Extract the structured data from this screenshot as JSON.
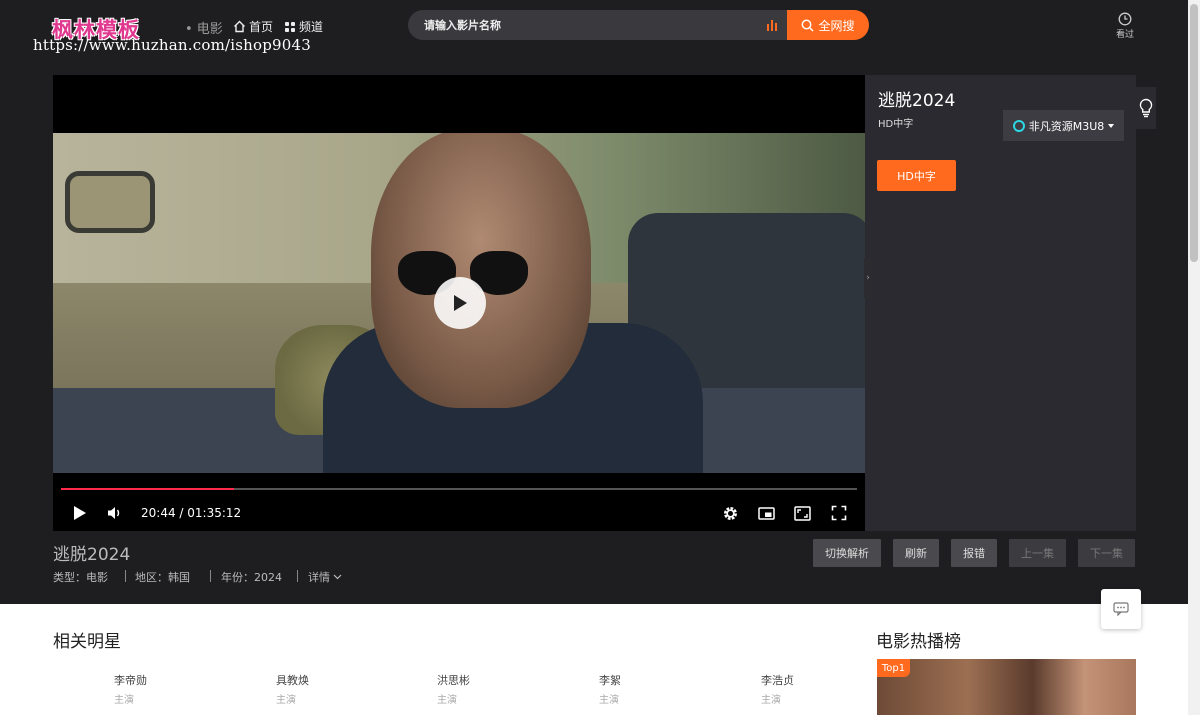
{
  "header": {
    "logo_text": "枫林模板",
    "logo_url": "https://www.huzhan.com/ishop9043",
    "category": "• 电影",
    "nav": [
      {
        "label": "首页",
        "icon": "home-icon"
      },
      {
        "label": "频道",
        "icon": "grid-icon"
      }
    ],
    "search_placeholder": "请输入影片名称",
    "search_button": "全网搜",
    "history_label": "看过"
  },
  "player": {
    "current_time": "20:44",
    "duration": "01:35:12",
    "time_display": "20:44 / 01:35:12",
    "progress_fraction": 0.2178,
    "progress_color": "#ff2a4a"
  },
  "panel": {
    "title": "逃脱2024",
    "subtitle": "HD中字",
    "source_label": "非凡资源M3U8",
    "episodes": [
      "HD中字"
    ]
  },
  "movie": {
    "title": "逃脱2024",
    "type": "类型：电影",
    "region": "地区：韩国",
    "year": "年份：2024",
    "details": "详情"
  },
  "actions": [
    "切换解析",
    "刷新",
    "报错",
    "上一集",
    "下一集"
  ],
  "stars_section": {
    "title": "相关明星",
    "stars": [
      {
        "name": "李帝勋",
        "role": "主演"
      },
      {
        "name": "具教焕",
        "role": "主演"
      },
      {
        "name": "洪思彬",
        "role": "主演"
      },
      {
        "name": "李絮",
        "role": "主演"
      },
      {
        "name": "李浩贞",
        "role": "主演"
      }
    ]
  },
  "hot_section": {
    "title": "电影热播榜",
    "top_badge": "Top1"
  },
  "colors": {
    "accent": "#ff6a1f",
    "background": "#1e1e20",
    "panel": "#2b2a30"
  }
}
